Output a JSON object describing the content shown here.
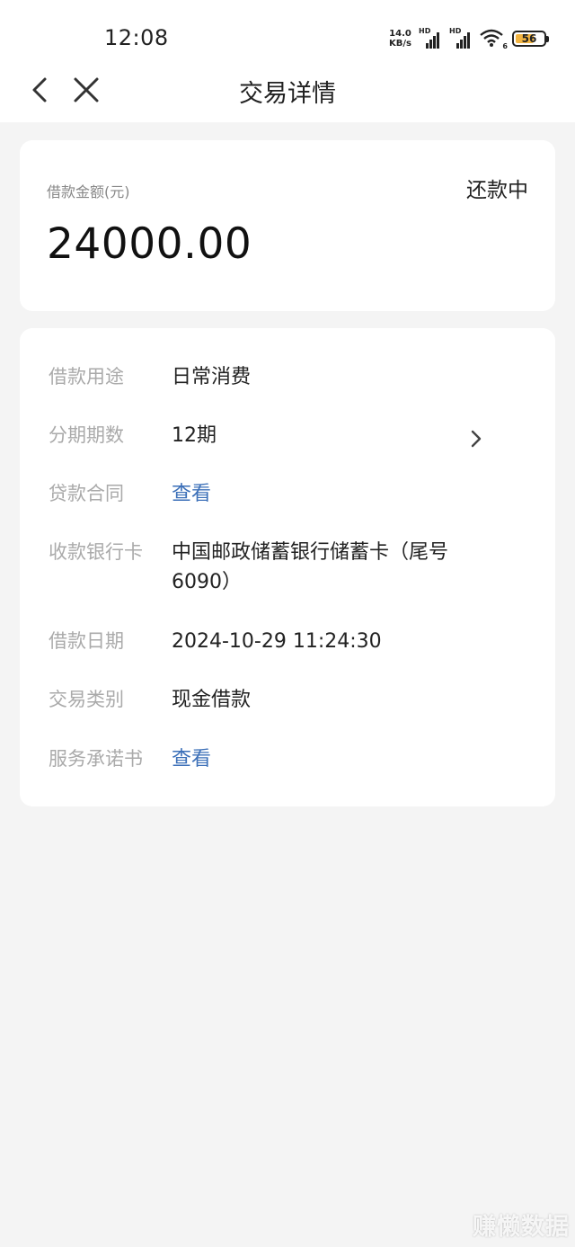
{
  "status_bar": {
    "time": "12:08",
    "net_speed_value": "14.0",
    "net_speed_unit": "KB/s",
    "signal1_tag": "HD",
    "signal2_tag": "HD",
    "wifi_tag": "6",
    "battery_level": "56",
    "battery_color": "#f2b441"
  },
  "nav": {
    "back_icon": "chevron-left",
    "close_icon": "close-x",
    "title": "交易详情"
  },
  "amount_card": {
    "label": "借款金额(元)",
    "status": "还款中",
    "amount": "24000.00"
  },
  "details": [
    {
      "label": "借款用途",
      "value": "日常消费",
      "link": false,
      "chevron": false
    },
    {
      "label": "分期期数",
      "value": "12期",
      "link": false,
      "chevron": true
    },
    {
      "label": "贷款合同",
      "value": "查看",
      "link": true,
      "chevron": false
    },
    {
      "label": "收款银行卡",
      "value": "中国邮政储蓄银行储蓄卡（尾号6090）",
      "link": false,
      "chevron": false
    },
    {
      "label": "借款日期",
      "value": "2024-10-29 11:24:30",
      "link": false,
      "chevron": false
    },
    {
      "label": "交易类别",
      "value": "现金借款",
      "link": false,
      "chevron": false
    },
    {
      "label": "服务承诺书",
      "value": "查看",
      "link": true,
      "chevron": false
    }
  ],
  "colors": {
    "link": "#3b6fb8",
    "background": "#f4f4f4",
    "card": "#ffffff"
  },
  "watermark": "赚懒数据"
}
